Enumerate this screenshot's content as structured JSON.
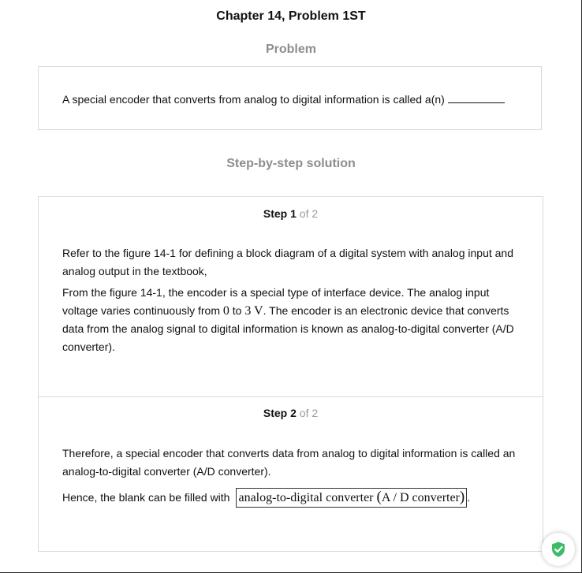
{
  "header": {
    "chapter_title": "Chapter 14, Problem 1ST",
    "problem_heading": "Problem",
    "solution_heading": "Step-by-step solution"
  },
  "problem": {
    "text": "A special encoder that converts from analog to digital information is called a(n)"
  },
  "steps": [
    {
      "word": "Step",
      "number": "1",
      "of": "of 2",
      "paragraphs": [
        "Refer to the figure 14-1 for defining a block diagram of a digital system with analog input and analog output in the textbook,"
      ],
      "p2": {
        "before": "From the figure 14-1, the encoder is a special type of interface device. The analog input voltage varies continuously from ",
        "math_zero": "0",
        "to_word": " to ",
        "math_three": "3 V",
        "after": ". The encoder is an electronic device that converts data from the analog signal to digital information is known as analog-to-digital converter (A/D converter)."
      }
    },
    {
      "word": "Step",
      "number": "2",
      "of": "of 2",
      "paragraphs": [
        "Therefore, a special encoder that converts data from analog to digital information is called an analog-to-digital converter (A/D converter)."
      ],
      "p2": {
        "before": "Hence, the blank can be filled with",
        "answer_main": "analog-to-digital converter",
        "answer_inner": "A / D converter",
        "after": "."
      }
    }
  ],
  "badge": {
    "icon": "shield-check-icon",
    "color": "#3dbb6a"
  }
}
